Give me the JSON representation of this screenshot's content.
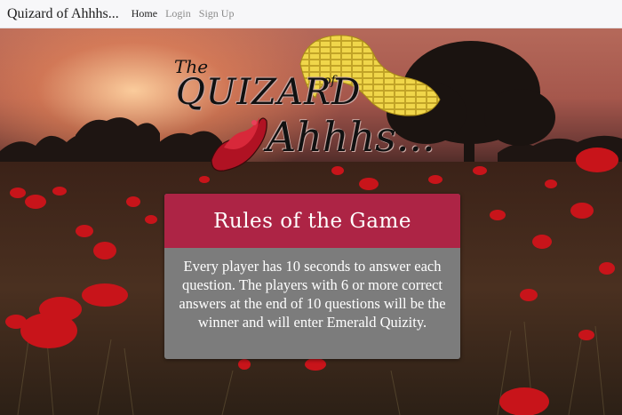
{
  "navbar": {
    "brand": "Quizard of Ahhhs...",
    "links": [
      {
        "label": "Home",
        "active": true
      },
      {
        "label": "Login",
        "active": false
      },
      {
        "label": "Sign Up",
        "active": false
      }
    ]
  },
  "logo": {
    "word_the": "The",
    "word_quizard": "QUIZARD",
    "word_of": "of",
    "word_ahhhs": "Ahhhs..."
  },
  "rules": {
    "title": "Rules of the Game",
    "body": "Every player has 10 seconds to answer each question. The players with 6 or more correct answers at the end of 10 questions will be the winner and will enter Emerald Quizity."
  },
  "colors": {
    "card_header": "#ad2445",
    "card_body": "#7c7c7c",
    "navbar_bg": "#f7f7f9",
    "poppy": "#c8141a"
  }
}
